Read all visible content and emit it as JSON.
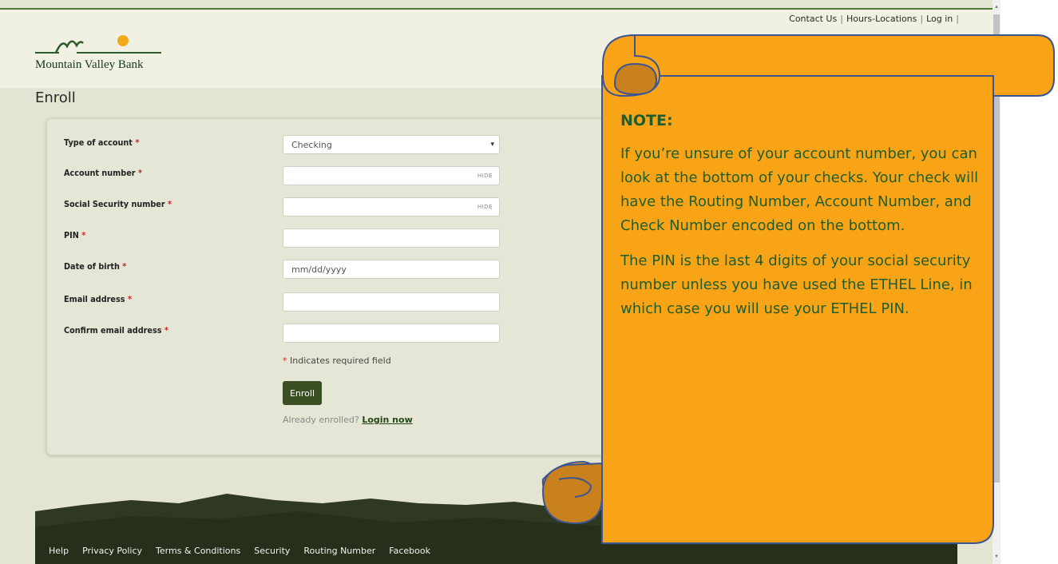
{
  "utility_nav": {
    "contact": "Contact Us",
    "hours": "Hours-Locations",
    "login": "Log in"
  },
  "logo": {
    "brand": "Mountain Valley Bank"
  },
  "page_title": "Enroll",
  "form": {
    "account_type": {
      "label": "Type of account",
      "value": "Checking"
    },
    "account_number": {
      "label": "Account number",
      "toggle": "HIDE"
    },
    "ssn": {
      "label": "Social Security number",
      "toggle": "HIDE"
    },
    "pin": {
      "label": "PIN"
    },
    "dob": {
      "label": "Date of birth",
      "placeholder": "mm/dd/yyyy"
    },
    "email": {
      "label": "Email address"
    },
    "confirm_email": {
      "label": "Confirm email address"
    },
    "required_marker": "*",
    "required_note": "Indicates required field",
    "submit_label": "Enroll",
    "already_text": "Already enrolled?",
    "login_link": "Login now"
  },
  "note": {
    "title": "NOTE:",
    "paragraph1": "If you’re unsure of your account number, you can look at the bottom of your checks.  Your check will have the Routing Number, Account Number, and Check Number encoded on the bottom.",
    "paragraph2": "The PIN is the last 4 digits of your social security number unless you have used the ETHEL Line, in which case you will use your ETHEL PIN."
  },
  "footer": {
    "links": [
      "Help",
      "Privacy Policy",
      "Terms & Conditions",
      "Security",
      "Routing Number",
      "Facebook"
    ]
  },
  "colors": {
    "brand_green": "#3b4f25",
    "note_fill": "#f9a317",
    "note_curl": "#c9811d",
    "note_text": "#1f5e2c",
    "footer": "#262f19"
  }
}
